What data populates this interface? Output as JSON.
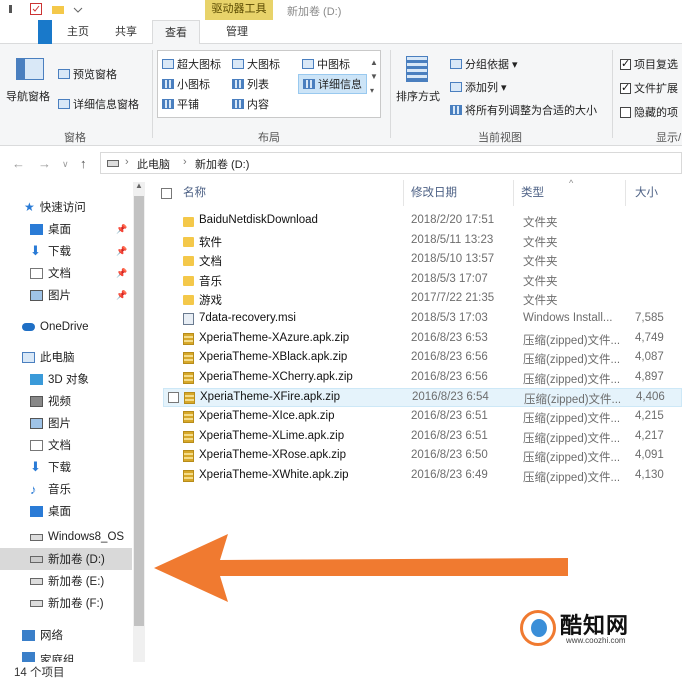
{
  "window": {
    "context_tab": "驱动器工具",
    "title": "新加卷 (D:)"
  },
  "tabs": [
    {
      "label": "主页"
    },
    {
      "label": "共享"
    },
    {
      "label": "查看"
    },
    {
      "label": "管理"
    }
  ],
  "ribbon": {
    "pane_group": {
      "nav_pane": "导航窗格",
      "preview_pane": "预览窗格",
      "details_pane": "详细信息窗格",
      "label": "窗格"
    },
    "layout_group": {
      "items": [
        "超大图标",
        "大图标",
        "中图标",
        "小图标",
        "列表",
        "详细信息",
        "平铺",
        "内容"
      ],
      "selected": "详细信息",
      "label": "布局"
    },
    "view_group": {
      "sort_by": "排序方式",
      "group_by": "分组依据",
      "add_column": "添加列",
      "fit_columns": "将所有列调整为合适的大小",
      "label": "当前视图"
    },
    "show_group": {
      "item_checkbox": "项目复选",
      "file_ext": "文件扩展",
      "hidden_items": "隐藏的项",
      "label": "显示/"
    }
  },
  "address": {
    "crumbs": [
      "此电脑",
      "新加卷 (D:)"
    ]
  },
  "nav": {
    "quick_access": "快速访问",
    "quick_items": [
      "桌面",
      "下载",
      "文档",
      "图片"
    ],
    "onedrive": "OneDrive",
    "this_pc": "此电脑",
    "pc_items": [
      "3D 对象",
      "视频",
      "图片",
      "文档",
      "下载",
      "音乐",
      "桌面",
      "Windows8_OS",
      "新加卷 (D:)",
      "新加卷 (E:)",
      "新加卷 (F:)"
    ],
    "selected": "新加卷 (D:)",
    "network": "网络",
    "partial": "家庭组"
  },
  "columns": {
    "name": "名称",
    "date": "修改日期",
    "type": "类型",
    "size": "大小"
  },
  "files": [
    {
      "name": "BaiduNetdiskDownload",
      "date": "2018/2/20 17:51",
      "type": "文件夹",
      "size": "",
      "kind": "folder"
    },
    {
      "name": "软件",
      "date": "2018/5/11 13:23",
      "type": "文件夹",
      "size": "",
      "kind": "folder"
    },
    {
      "name": "文档",
      "date": "2018/5/10 13:57",
      "type": "文件夹",
      "size": "",
      "kind": "folder"
    },
    {
      "name": "音乐",
      "date": "2018/5/3 17:07",
      "type": "文件夹",
      "size": "",
      "kind": "folder"
    },
    {
      "name": "游戏",
      "date": "2017/7/22 21:35",
      "type": "文件夹",
      "size": "",
      "kind": "folder"
    },
    {
      "name": "7data-recovery.msi",
      "date": "2018/5/3 17:03",
      "type": "Windows Install...",
      "size": "7,585",
      "kind": "msi"
    },
    {
      "name": "XperiaTheme-XAzure.apk.zip",
      "date": "2016/8/23 6:53",
      "type": "压缩(zipped)文件...",
      "size": "4,749",
      "kind": "zip"
    },
    {
      "name": "XperiaTheme-XBlack.apk.zip",
      "date": "2016/8/23 6:56",
      "type": "压缩(zipped)文件...",
      "size": "4,087",
      "kind": "zip"
    },
    {
      "name": "XperiaTheme-XCherry.apk.zip",
      "date": "2016/8/23 6:56",
      "type": "压缩(zipped)文件...",
      "size": "4,897",
      "kind": "zip"
    },
    {
      "name": "XperiaTheme-XFire.apk.zip",
      "date": "2016/8/23 6:54",
      "type": "压缩(zipped)文件...",
      "size": "4,406",
      "kind": "zip"
    },
    {
      "name": "XperiaTheme-XIce.apk.zip",
      "date": "2016/8/23 6:51",
      "type": "压缩(zipped)文件...",
      "size": "4,215",
      "kind": "zip"
    },
    {
      "name": "XperiaTheme-XLime.apk.zip",
      "date": "2016/8/23 6:51",
      "type": "压缩(zipped)文件...",
      "size": "4,217",
      "kind": "zip"
    },
    {
      "name": "XperiaTheme-XRose.apk.zip",
      "date": "2016/8/23 6:50",
      "type": "压缩(zipped)文件...",
      "size": "4,091",
      "kind": "zip"
    },
    {
      "name": "XperiaTheme-XWhite.apk.zip",
      "date": "2016/8/23 6:49",
      "type": "压缩(zipped)文件...",
      "size": "4,130",
      "kind": "zip"
    }
  ],
  "hover_row": "XperiaTheme-XFire.apk.zip",
  "status": {
    "count": "14 个项目"
  },
  "watermark": {
    "brand": "酷知网",
    "url": "www.coozhi.com"
  },
  "colors": {
    "arrow": "#f07a30",
    "context_tab": "#e8d36a",
    "selection": "#cce4f7",
    "hover": "#e5f3fb"
  }
}
